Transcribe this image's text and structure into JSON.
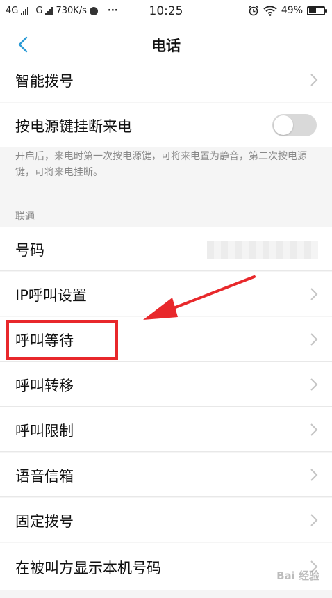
{
  "status_bar": {
    "network1": "4G",
    "network2": "G",
    "speed": "730K/s",
    "dots": "···",
    "time": "10:25",
    "battery": "49%"
  },
  "header": {
    "title": "电话"
  },
  "rows": {
    "smart_dial": "智能拨号",
    "power_key_hangup": "按电源键挂断来电",
    "number": "号码",
    "ip_call": "IP呼叫设置",
    "call_waiting": "呼叫等待",
    "call_forwarding": "呼叫转移",
    "call_barring": "呼叫限制",
    "voicemail": "语音信箱",
    "fixed_dialing": "固定拨号",
    "show_number": "在被叫方显示本机号码"
  },
  "power_key_description": "开启后，来电时第一次按电源键，可将来电置为静音，第二次按电源键，可将来电挂断。",
  "section_label": "联通",
  "toggle_power_key_on": false,
  "watermark": "Bai 经验",
  "colors": {
    "accent_back": "#2a9bd6",
    "highlight": "#e8282b"
  }
}
